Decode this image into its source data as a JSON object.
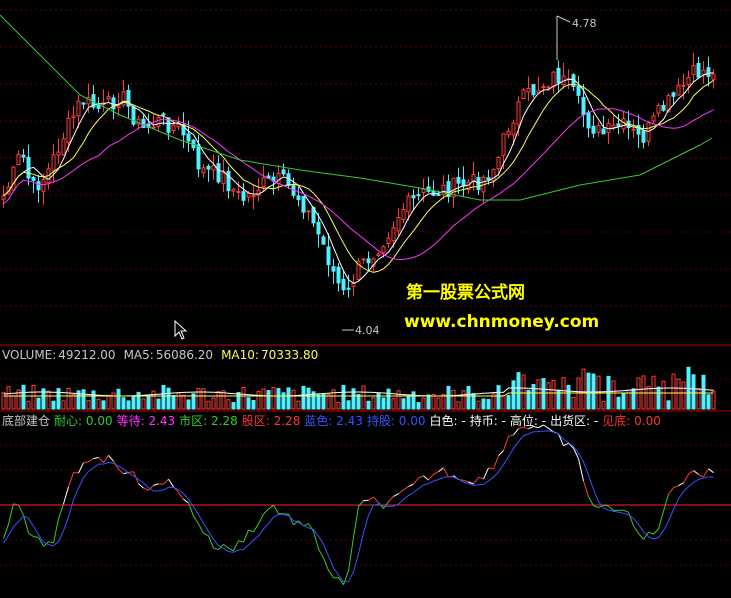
{
  "price_panel": {
    "high_label": "4.78",
    "low_label": "4.04",
    "colors": {
      "up": "#ff3c3c",
      "down": "#4ff0ff",
      "ma_white": "#ffffff",
      "ma_yellow": "#ffff55",
      "ma_magenta": "#ff33ff",
      "ma_green": "#33cc33"
    }
  },
  "watermark": {
    "title": "第一股票公式网",
    "url": "www.chnmoney.com",
    "color": "#ffff00"
  },
  "volume_panel": {
    "vol_label": "VOLUME:",
    "vol_value": "49212.00",
    "ma5_label": "MA5:",
    "ma5_value": "56086.20",
    "ma10_label": "MA10:",
    "ma10_value": "70333.80"
  },
  "indicator_panel": {
    "items": [
      {
        "text": "底部建仓",
        "color": "#c8c8c8"
      },
      {
        "text": "耐心: 0.00",
        "color": "#33cc33"
      },
      {
        "text": "等待: 2.43",
        "color": "#ff33ff"
      },
      {
        "text": "市区: 2.28",
        "color": "#33cc33"
      },
      {
        "text": "股区: 2.28",
        "color": "#ff3333"
      },
      {
        "text": "蓝色: 2.43",
        "color": "#3355ff"
      },
      {
        "text": "持股: 0.00",
        "color": "#3355ff"
      },
      {
        "text": "白色: -",
        "color": "#ffffff"
      },
      {
        "text": "持币: -",
        "color": "#ffffff"
      },
      {
        "text": "高位: -",
        "color": "#ffffff"
      },
      {
        "text": "出货区: -",
        "color": "#ffffff"
      },
      {
        "text": "见底: 0.00",
        "color": "#ff3333"
      }
    ]
  }
}
